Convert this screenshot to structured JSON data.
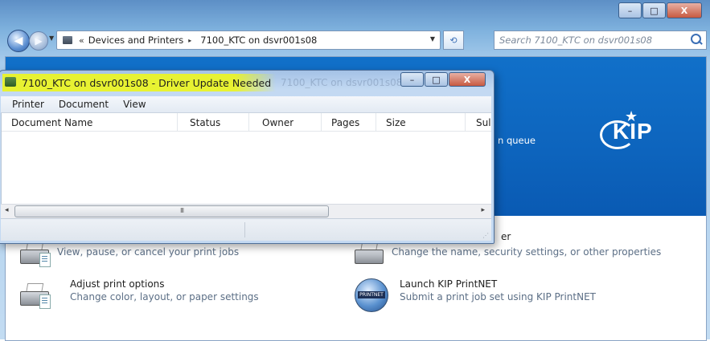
{
  "explorer": {
    "address": {
      "overflow": "«",
      "crumbs": [
        "Devices and Printers",
        "7100_KTC on dsvr001s08"
      ],
      "separator": "▸"
    },
    "search": {
      "placeholder": "Search 7100_KTC on dsvr001s08"
    },
    "caption": {
      "minimize": "–",
      "maximize": "□",
      "close": "X"
    }
  },
  "banner": {
    "queue_text": "n queue",
    "logo": "KIP"
  },
  "tasks": [
    {
      "title": "",
      "subtitle": "View, pause, or cancel your print jobs",
      "icon": "printer-icon"
    },
    {
      "title": "er",
      "subtitle": "Change the name, security settings, or other properties",
      "icon": "printer-pen-icon"
    },
    {
      "title": "Adjust print options",
      "subtitle": "Change color, layout, or paper settings",
      "icon": "printer-options-icon"
    },
    {
      "title": "Launch KIP PrintNET",
      "subtitle": "Submit a print job set using KIP PrintNET",
      "icon": "printnet-globe-icon",
      "icon_label": "PRINTNET"
    }
  ],
  "queue_window": {
    "title": "7100_KTC on dsvr001s08 - Driver Update Needed",
    "ghost_title": "7100_KTC on dsvr001s08",
    "highlight_color": "#eaf428",
    "caption": {
      "minimize": "–",
      "maximize": "□",
      "close": "X"
    },
    "menu": [
      "Printer",
      "Document",
      "View"
    ],
    "columns": [
      "Document Name",
      "Status",
      "Owner",
      "Pages",
      "Size",
      "Sul"
    ],
    "rows": [],
    "scroll": {
      "left": "◂",
      "right": "▸",
      "grip": "III"
    }
  },
  "colors": {
    "banner": "#0d64bd",
    "title_highlight": "#eaf428"
  }
}
